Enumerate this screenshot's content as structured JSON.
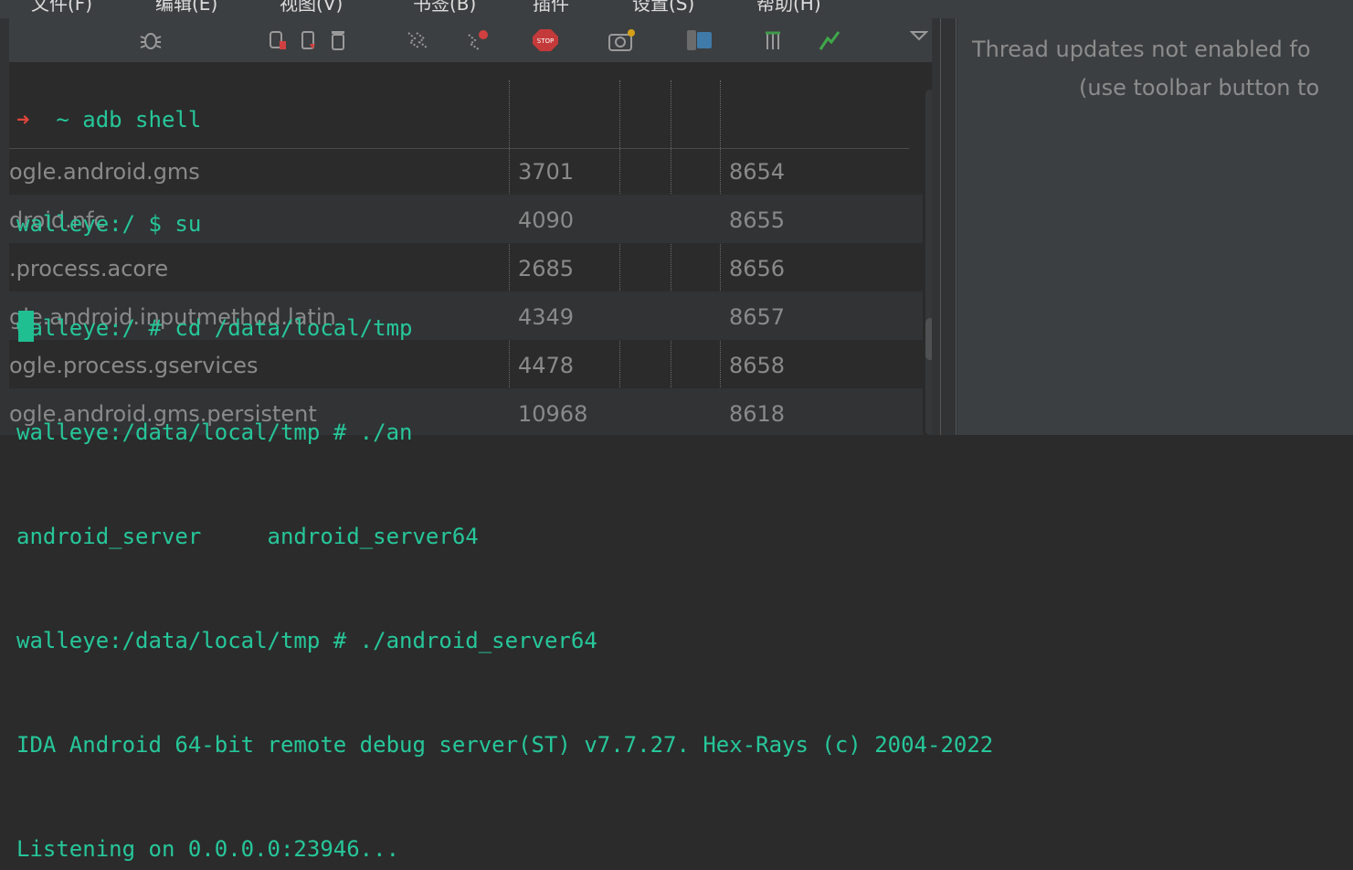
{
  "menubar": {
    "items": [
      "文件(F)",
      "编辑(E)",
      "视图(V)",
      "书签(B)",
      "插件",
      "设置(S)",
      "帮助(H)"
    ]
  },
  "toolbar": {
    "icons": [
      "bug-icon",
      "debug-stop-icon",
      "trash-red-icon",
      "trash-icon",
      "trace-icon",
      "trace-red-icon",
      "stop-icon",
      "snapshot-icon",
      "device-icon",
      "columns-icon",
      "chart-icon",
      "dropdown-icon"
    ]
  },
  "process_list": {
    "rows": [
      {
        "name": "ogle.android.gms",
        "pid": "3701",
        "col3": "8654"
      },
      {
        "name": "droid.nfc",
        "pid": "4090",
        "col3": "8655"
      },
      {
        "name": ".process.acore",
        "pid": "2685",
        "col3": "8656"
      },
      {
        "name": "gle.android.inputmethod.latin",
        "pid": "4349",
        "col3": "8657"
      },
      {
        "name": "ogle.process.gservices",
        "pid": "4478",
        "col3": "8658"
      },
      {
        "name": "ogle.android.gms.persistent",
        "pid": "10968",
        "col3": "8618"
      }
    ]
  },
  "right_panel": {
    "line1": "Thread updates not enabled fo",
    "line2": "(use toolbar button to"
  },
  "terminal": {
    "prompt_arrow": "➜",
    "line0": "  ~ adb shell",
    "line1": "walleye:/ $ su",
    "line2": "walleye:/ # cd /data/local/tmp",
    "line3": "walleye:/data/local/tmp # ./an",
    "line4": "android_server     android_server64",
    "line5": "walleye:/data/local/tmp # ./android_server64",
    "line6": "IDA Android 64-bit remote debug server(ST) v7.7.27. Hex-Rays (c) 2004-2022",
    "line7": "Listening on 0.0.0.0:23946..."
  },
  "colors": {
    "terminal_text": "#26c79a",
    "arrow": "#e0443a",
    "cursor": "#1fbf92"
  }
}
